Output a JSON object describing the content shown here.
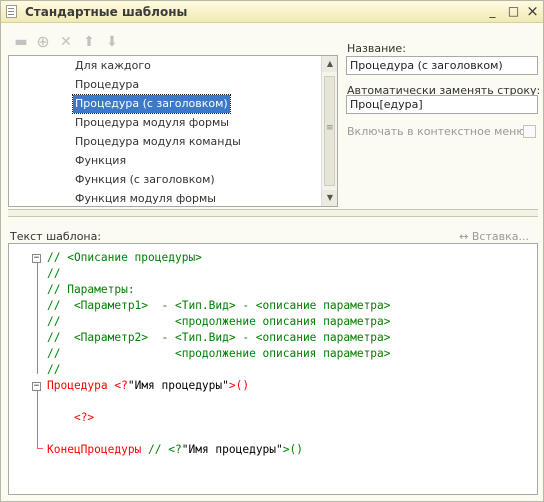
{
  "window": {
    "title": "Стандартные шаблоны",
    "minimize": "_",
    "maximize": "□",
    "close": "×"
  },
  "toolbar": {
    "add_folder": "▬",
    "add": "⊕",
    "delete": "✕",
    "up": "⬆",
    "down": "⬇"
  },
  "template_list": {
    "items": [
      "Для каждого",
      "Процедура",
      "Процедура (с заголовком)",
      "Процедура модуля формы",
      "Процедура модуля команды",
      "Функция",
      "Функция (с заголовком)",
      "Функция модуля формы"
    ],
    "selected_index": 2
  },
  "properties": {
    "name_label": "Название:",
    "name_value": "Процедура (с заголовком)",
    "autoreplace_label": "Автоматически заменять строку:",
    "autoreplace_value": "Проц[едура]",
    "context_menu_label": "Включать в контекстное меню",
    "context_menu_checked": false
  },
  "editor": {
    "label": "Текст шаблона:",
    "paste_label": "↔ Вставка...",
    "lines": [
      [
        {
          "t": "// <Описание процедуры>",
          "c": "green"
        }
      ],
      [
        {
          "t": "//",
          "c": "green"
        }
      ],
      [
        {
          "t": "// Параметры:",
          "c": "green"
        }
      ],
      [
        {
          "t": "//  <Параметр1>  - <Тип.Вид> - <описание параметра>",
          "c": "green"
        }
      ],
      [
        {
          "t": "//                 <продолжение описания параметра>",
          "c": "green"
        }
      ],
      [
        {
          "t": "//  <Параметр2>  - <Тип.Вид> - <описание параметра>",
          "c": "green"
        }
      ],
      [
        {
          "t": "//                 <продолжение описания параметра>",
          "c": "green"
        }
      ],
      [
        {
          "t": "//",
          "c": "green"
        }
      ],
      [
        {
          "t": "Процедура ",
          "c": "red"
        },
        {
          "t": "<?",
          "c": "red"
        },
        {
          "t": "\"Имя процедуры\"",
          "c": "black"
        },
        {
          "t": ">()",
          "c": "red"
        }
      ],
      [],
      [
        {
          "t": "    ",
          "c": "black"
        },
        {
          "t": "<?>",
          "c": "red"
        }
      ],
      [],
      [
        {
          "t": "КонецПроцедуры ",
          "c": "red"
        },
        {
          "t": "// <?",
          "c": "green"
        },
        {
          "t": "\"Имя процедуры\"",
          "c": "black"
        },
        {
          "t": ">()",
          "c": "green"
        }
      ]
    ]
  }
}
